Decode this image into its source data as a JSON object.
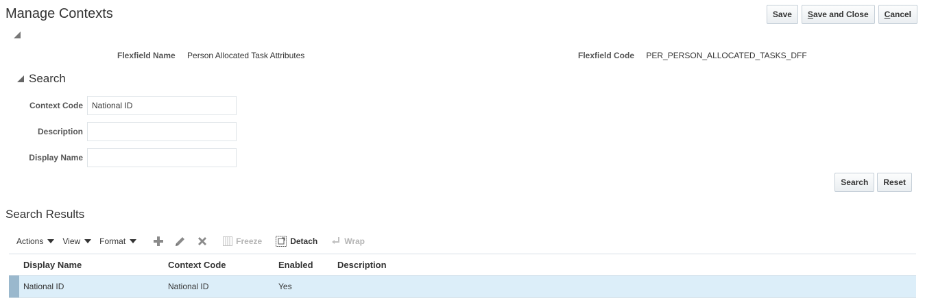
{
  "page": {
    "title": "Manage Contexts"
  },
  "top_buttons": {
    "save": "Save",
    "save_and_close_u": "S",
    "save_and_close_rest": "ave and Close",
    "cancel_u": "C",
    "cancel_rest": "ancel"
  },
  "flexfield": {
    "name_label": "Flexfield Name",
    "name_value": "Person Allocated Task Attributes",
    "code_label": "Flexfield Code",
    "code_value": "PER_PERSON_ALLOCATED_TASKS_DFF"
  },
  "search": {
    "title": "Search",
    "fields": [
      {
        "label": "Context Code",
        "value": "National ID"
      },
      {
        "label": "Description",
        "value": ""
      },
      {
        "label": "Display Name",
        "value": ""
      }
    ],
    "search_button": "Search",
    "reset_button": "Reset"
  },
  "results": {
    "title": "Search Results",
    "toolbar": {
      "actions": "Actions",
      "view": "View",
      "format": "Format",
      "freeze": "Freeze",
      "detach": "Detach",
      "wrap": "Wrap"
    },
    "columns": [
      "Display Name",
      "Context Code",
      "Enabled",
      "Description"
    ],
    "rows": [
      {
        "display_name": "National ID",
        "context_code": "National ID",
        "enabled": "Yes",
        "description": ""
      }
    ]
  },
  "colors": {
    "selected_row": "#dceef9",
    "row_marker": "#9ab8cd",
    "icon_gray": "#8a8a8a"
  }
}
